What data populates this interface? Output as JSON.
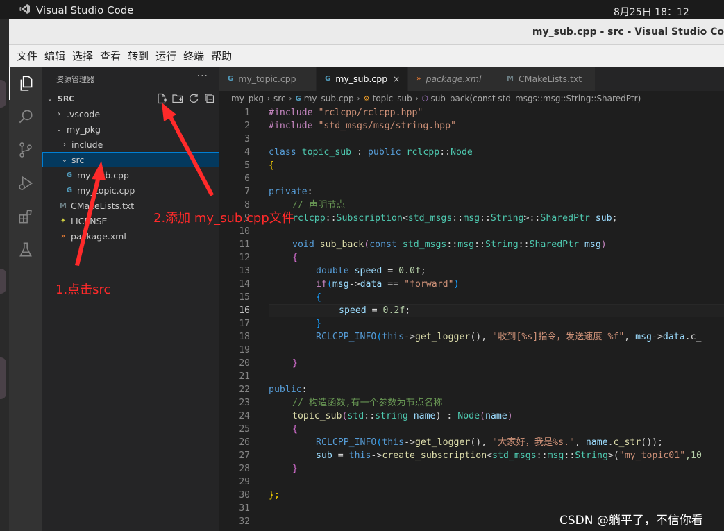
{
  "os": {
    "app_name": "Visual Studio Code",
    "clock": "8月25日  18：12"
  },
  "window": {
    "title": "my_sub.cpp - src - Visual Studio Co"
  },
  "menu": [
    "文件",
    "编辑",
    "选择",
    "查看",
    "转到",
    "运行",
    "终端",
    "帮助"
  ],
  "activity_bar": [
    "files-icon",
    "search-icon",
    "source-control-icon",
    "run-debug-icon",
    "extensions-icon",
    "test-flask-icon"
  ],
  "explorer": {
    "header": "资源管理器",
    "more": "···",
    "section": "SRC",
    "items": [
      {
        "label": ".vscode",
        "chev": "›",
        "icon": ""
      },
      {
        "label": "my_pkg",
        "chev": "⌄",
        "icon": ""
      },
      {
        "label": "include",
        "chev": "›",
        "icon": ""
      },
      {
        "label": "src",
        "chev": "⌄",
        "icon": ""
      },
      {
        "label": "my_sub.cpp",
        "chev": "",
        "icon": "G"
      },
      {
        "label": "my_topic.cpp",
        "chev": "",
        "icon": "G"
      },
      {
        "label": "CMakeLists.txt",
        "chev": "",
        "icon": "M"
      },
      {
        "label": "LICENSE",
        "chev": "",
        "icon": "✦"
      },
      {
        "label": "package.xml",
        "chev": "",
        "icon": "»"
      }
    ]
  },
  "tabs": [
    {
      "label": "my_topic.cpp",
      "icon": "G"
    },
    {
      "label": "my_sub.cpp",
      "icon": "G",
      "close": "×"
    },
    {
      "label": "package.xml",
      "icon": "»"
    },
    {
      "label": "CMakeLists.txt",
      "icon": "M"
    }
  ],
  "breadcrumb": [
    "my_pkg",
    "src",
    "my_sub.cpp",
    "topic_sub",
    "sub_back(const std_msgs::msg::String::SharedPtr)"
  ],
  "line_numbers": [
    "1",
    "2",
    "3",
    "4",
    "5",
    "6",
    "7",
    "8",
    "9",
    "10",
    "11",
    "12",
    "13",
    "14",
    "15",
    "16",
    "17",
    "18",
    "19",
    "20",
    "21",
    "22",
    "23",
    "24",
    "25",
    "26",
    "27",
    "28",
    "29",
    "30",
    "31",
    "32"
  ],
  "code": {
    "l1a": "#include",
    "l1b": " \"rclcpp/rclcpp.hpp\"",
    "l2a": "#include",
    "l2b": " \"std_msgs/msg/string.hpp\"",
    "l4a": "class",
    "l4b": "topic_sub",
    "l4c": " : ",
    "l4d": "public",
    "l4e": "rclcpp",
    "l4f": "::",
    "l4g": "Node",
    "l5": "{",
    "l7a": "private",
    "l7b": ":",
    "l8": "// 声明节点",
    "l9a": "rclcpp",
    "l9b": "::",
    "l9c": "Subscription",
    "l9d": "<",
    "l9e": "std_msgs",
    "l9f": "::",
    "l9g": "msg",
    "l9h": "::",
    "l9i": "String",
    "l9j": ">::",
    "l9k": "SharedPtr",
    "l9l": "sub",
    "l9m": ";",
    "l11a": "void",
    "l11b": "sub_back",
    "l11c": "(",
    "l11d": "const",
    "l11e": "std_msgs",
    "l11f": "::",
    "l11g": "msg",
    "l11h": "::",
    "l11i": "String",
    "l11j": "::",
    "l11k": "SharedPtr",
    "l11l": "msg",
    "l11m": ")",
    "l12": "{",
    "l13a": "double",
    "l13b": "speed",
    "l13c": " = ",
    "l13d": "0.0f",
    "l13e": ";",
    "l14a": "if",
    "l14b": "(",
    "l14c": "msg",
    "l14d": "->",
    "l14e": "data",
    "l14f": " == ",
    "l14g": "\"forward\"",
    "l14h": ")",
    "l15": "{",
    "l16a": "speed",
    "l16b": " = ",
    "l16c": "0.2f",
    "l16d": ";",
    "l17": "}",
    "l18a": "RCLCPP_INFO",
    "l18b": "(",
    "l18c": "this",
    "l18d": "->",
    "l18e": "get_logger",
    "l18f": "(), ",
    "l18g": "\"收到[%s]指令，发送速度 %f\"",
    "l18h": ", ",
    "l18i": "msg",
    "l18j": "->",
    "l18k": "data",
    "l18l": ".c_",
    "l20": "}",
    "l22a": "public",
    "l22b": ":",
    "l23": "// 构造函数,有一个参数为节点名称",
    "l24a": "topic_sub",
    "l24b": "(",
    "l24c": "std",
    "l24d": "::",
    "l24e": "string",
    "l24f": "name",
    "l24g": ") : ",
    "l24h": "Node",
    "l24i": "(",
    "l24j": "name",
    "l24k": ")",
    "l25": "{",
    "l26a": "RCLCPP_INFO",
    "l26b": "(",
    "l26c": "this",
    "l26d": "->",
    "l26e": "get_logger",
    "l26f": "(), ",
    "l26g": "\"大家好，我是%s.\"",
    "l26h": ", ",
    "l26i": "name",
    "l26j": ".",
    "l26k": "c_str",
    "l26l": "());",
    "l27a": "sub",
    "l27b": " = ",
    "l27c": "this",
    "l27d": "->",
    "l27e": "create_subscription",
    "l27f": "<",
    "l27g": "std_msgs",
    "l27h": "::",
    "l27i": "msg",
    "l27j": "::",
    "l27k": "String",
    "l27l": ">(",
    "l27m": "\"my_topic01\"",
    "l27n": ",10",
    "l28": "}",
    "l30": "};"
  },
  "annotations": {
    "step1": "1.点击src",
    "step2": "2.添加 my_sub.cpp文件"
  },
  "watermark": "CSDN @躺平了，不信你看",
  "colors": {
    "accent": "#007fd4",
    "annotation": "#ff2a2a",
    "cpp_icon": "#519aba",
    "cmake_icon": "#6d8086",
    "xml_icon": "#e37933",
    "license_icon": "#cbcb41"
  }
}
